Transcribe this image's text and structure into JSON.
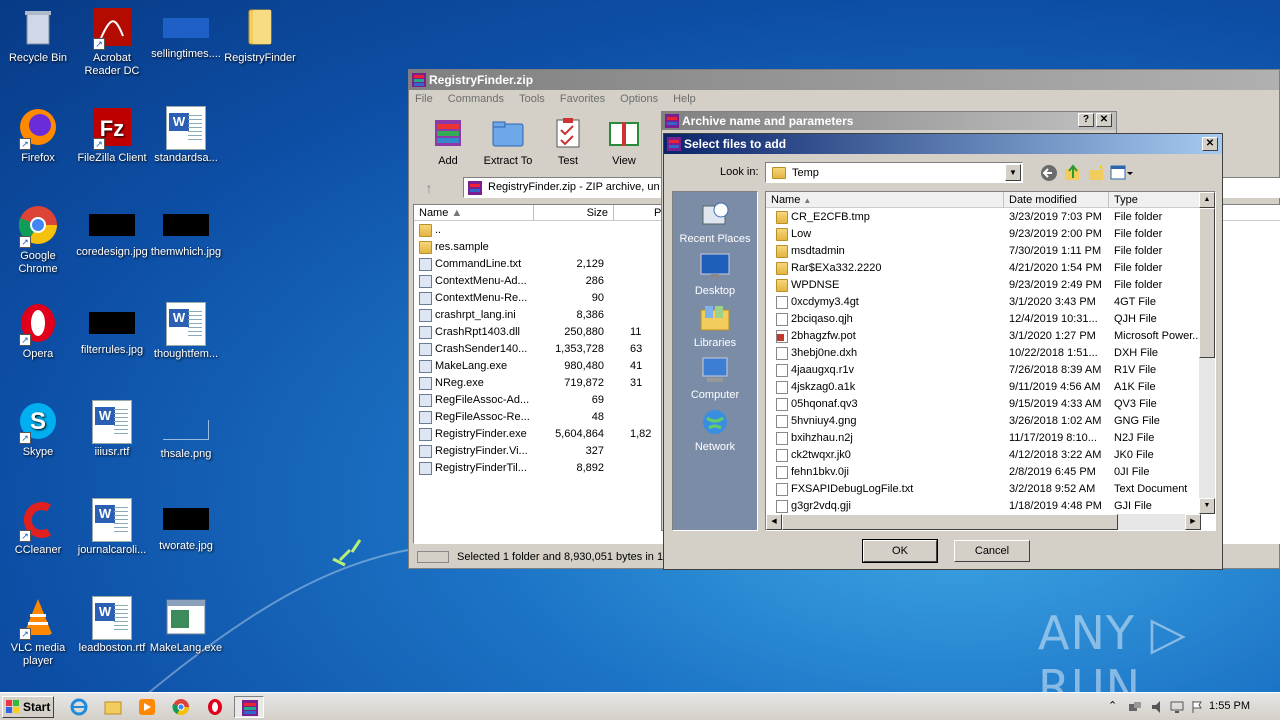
{
  "desktop": {
    "icons": [
      {
        "label": "Recycle Bin"
      },
      {
        "label": "Acrobat Reader DC"
      },
      {
        "label": "sellingtimes...."
      },
      {
        "label": "RegistryFinder"
      },
      {
        "label": "Firefox"
      },
      {
        "label": "FileZilla Client"
      },
      {
        "label": "standardsa..."
      },
      {
        "label": "Google Chrome"
      },
      {
        "label": "coredesign.jpg"
      },
      {
        "label": "themwhich.jpg"
      },
      {
        "label": "Opera"
      },
      {
        "label": "filterrules.jpg"
      },
      {
        "label": "thoughtfem..."
      },
      {
        "label": "Skype"
      },
      {
        "label": "iiiusr.rtf"
      },
      {
        "label": "thsale.png"
      },
      {
        "label": "CCleaner"
      },
      {
        "label": "journalcaroli..."
      },
      {
        "label": "tworate.jpg"
      },
      {
        "label": "VLC media player"
      },
      {
        "label": "leadboston.rtf"
      },
      {
        "label": "MakeLang.exe"
      }
    ]
  },
  "winrar": {
    "title": "RegistryFinder.zip",
    "menu": [
      "File",
      "Commands",
      "Tools",
      "Favorites",
      "Options",
      "Help"
    ],
    "toolbar": [
      "Add",
      "Extract To",
      "Test",
      "View"
    ],
    "path": "RegistryFinder.zip - ZIP archive, un",
    "columns": {
      "name": "Name",
      "size": "Size",
      "packed": "P"
    },
    "rows": [
      {
        "name": "..",
        "size": "",
        "packed": ""
      },
      {
        "name": "res.sample",
        "size": "",
        "packed": ""
      },
      {
        "name": "CommandLine.txt",
        "size": "2,129",
        "packed": ""
      },
      {
        "name": "ContextMenu-Ad...",
        "size": "286",
        "packed": ""
      },
      {
        "name": "ContextMenu-Re...",
        "size": "90",
        "packed": ""
      },
      {
        "name": "crashrpt_lang.ini",
        "size": "8,386",
        "packed": ""
      },
      {
        "name": "CrashRpt1403.dll",
        "size": "250,880",
        "packed": "11"
      },
      {
        "name": "CrashSender140...",
        "size": "1,353,728",
        "packed": "63"
      },
      {
        "name": "MakeLang.exe",
        "size": "980,480",
        "packed": "41"
      },
      {
        "name": "NReg.exe",
        "size": "719,872",
        "packed": "31"
      },
      {
        "name": "RegFileAssoc-Ad...",
        "size": "69",
        "packed": ""
      },
      {
        "name": "RegFileAssoc-Re...",
        "size": "48",
        "packed": ""
      },
      {
        "name": "RegistryFinder.exe",
        "size": "5,604,864",
        "packed": "1,82"
      },
      {
        "name": "RegistryFinder.Vi...",
        "size": "327",
        "packed": ""
      },
      {
        "name": "RegistryFinderTil...",
        "size": "8,892",
        "packed": ""
      }
    ],
    "status": "Selected 1 folder and 8,930,051 bytes in 1"
  },
  "archive_dialog": {
    "title": "Archive name and parameters",
    "help": "?",
    "close": "✕"
  },
  "select_dialog": {
    "title": "Select files to add",
    "close": "✕",
    "look_in_label": "Look in:",
    "look_in_value": "Temp",
    "places": [
      "Recent Places",
      "Desktop",
      "Libraries",
      "Computer",
      "Network"
    ],
    "columns": {
      "name": "Name",
      "date": "Date modified",
      "type": "Type"
    },
    "files": [
      {
        "name": "CR_E2CFB.tmp",
        "date": "3/23/2019 7:03 PM",
        "type": "File folder",
        "kind": "folder"
      },
      {
        "name": "Low",
        "date": "9/23/2019 2:00 PM",
        "type": "File folder",
        "kind": "folder"
      },
      {
        "name": "msdtadmin",
        "date": "7/30/2019 1:11 PM",
        "type": "File folder",
        "kind": "folder"
      },
      {
        "name": "Rar$EXa332.2220",
        "date": "4/21/2020 1:54 PM",
        "type": "File folder",
        "kind": "folder"
      },
      {
        "name": "WPDNSE",
        "date": "9/23/2019 2:49 PM",
        "type": "File folder",
        "kind": "folder"
      },
      {
        "name": "0xcdymy3.4gt",
        "date": "3/1/2020 3:43 PM",
        "type": "4GT File",
        "kind": "file"
      },
      {
        "name": "2bciqaso.qjh",
        "date": "12/4/2019 10:31...",
        "type": "QJH File",
        "kind": "file"
      },
      {
        "name": "2bhagzfw.pot",
        "date": "3/1/2020 1:27 PM",
        "type": "Microsoft Power...",
        "kind": "ppt"
      },
      {
        "name": "3hebj0ne.dxh",
        "date": "10/22/2018 1:51...",
        "type": "DXH File",
        "kind": "file"
      },
      {
        "name": "4jaaugxq.r1v",
        "date": "7/26/2018 8:39 AM",
        "type": "R1V File",
        "kind": "file"
      },
      {
        "name": "4jskzag0.a1k",
        "date": "9/11/2019 4:56 AM",
        "type": "A1K File",
        "kind": "file"
      },
      {
        "name": "05hqonaf.qv3",
        "date": "9/15/2019 4:33 AM",
        "type": "QV3 File",
        "kind": "file"
      },
      {
        "name": "5hvniuy4.gng",
        "date": "3/26/2018 1:02 AM",
        "type": "GNG File",
        "kind": "file"
      },
      {
        "name": "bxihzhau.n2j",
        "date": "11/17/2019 8:10...",
        "type": "N2J File",
        "kind": "file"
      },
      {
        "name": "ck2twqxr.jk0",
        "date": "4/12/2018 3:22 AM",
        "type": "JK0 File",
        "kind": "file"
      },
      {
        "name": "fehn1bkv.0ji",
        "date": "2/8/2019 6:45 PM",
        "type": "0JI File",
        "kind": "file"
      },
      {
        "name": "FXSAPIDebugLogFile.txt",
        "date": "3/2/2018 9:52 AM",
        "type": "Text Document",
        "kind": "file"
      },
      {
        "name": "g3gr2vdq.gji",
        "date": "1/18/2019 4:48 PM",
        "type": "GJI File",
        "kind": "file"
      }
    ],
    "ok": "OK",
    "cancel": "Cancel"
  },
  "taskbar": {
    "start": "Start",
    "clock": "1:55 PM"
  },
  "watermark": "ANY ▷ RUN",
  "colors": {
    "title_active": "#0a246a",
    "title_inactive": "#808080",
    "selection": "#3399ff",
    "places_bg": "#7b8ca7"
  }
}
